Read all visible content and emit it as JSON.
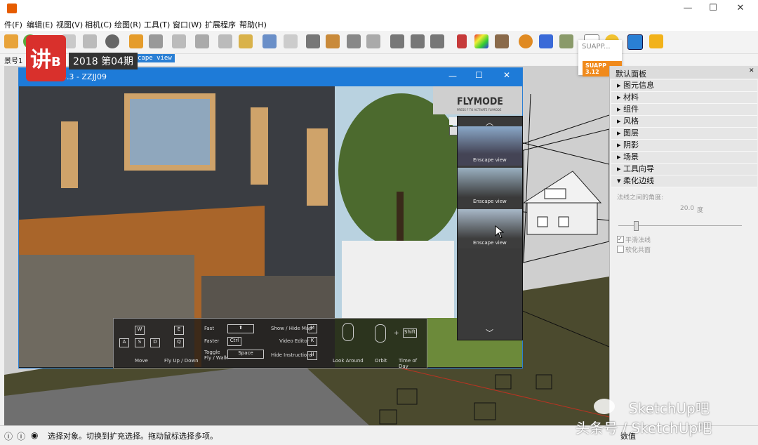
{
  "window": {
    "title_partial": "",
    "minimize": "—",
    "maximize": "☐",
    "close": "✕"
  },
  "menu": [
    "件(F)",
    "编辑(E)",
    "视图(V)",
    "相机(C)",
    "绘图(R)",
    "工具(T)",
    "窗口(W)",
    "扩展程序",
    "帮助(H)"
  ],
  "scene_tab": {
    "label": "景号1",
    "active": "cape view"
  },
  "overlay": {
    "logo_text": "讲",
    "logo_sub": "B",
    "issue": "2018 第04期"
  },
  "suapp": {
    "label": "SUAPP...",
    "badge": "SUAPP 3.12"
  },
  "enscape": {
    "title": "E 2.3.3 - ZZJJ09",
    "flymode_title": "FLYMODE",
    "flymode_sub": "PRESS F TO ACTIVATE FLYMODE",
    "thumbs": [
      "Enscape view",
      "Enscape view",
      "Enscape view"
    ],
    "scroll_up": "︿",
    "scroll_down": "﹀",
    "hud": {
      "keys_move": [
        "W",
        "A",
        "S",
        "D"
      ],
      "keys_fly": [
        "E",
        "Q"
      ],
      "move_label": "Move",
      "fly_label": "Fly Up / Down",
      "fast": "Fast",
      "faster": "Faster",
      "toggle": "Toggle\nFly / Walk",
      "ctrl": "Ctrl",
      "space": "Space",
      "shift_sym": "⬆",
      "show_map": "Show / Hide Map",
      "video_editor": "Video Editor",
      "hide_instr": "Hide Instructions",
      "key_m": "M",
      "key_k": "K",
      "key_h": "H",
      "look_around": "Look Around",
      "orbit": "Orbit",
      "plus": "+",
      "shift": "Shift",
      "time_of_day": "Time of Day"
    }
  },
  "panel": {
    "header": "默认面板",
    "sections": [
      "图元信息",
      "材料",
      "组件",
      "风格",
      "图层",
      "阴影",
      "场景",
      "工具向导",
      "柔化边线"
    ],
    "soften": {
      "angle_label": "法线之间的角度:",
      "angle_value": "20.0",
      "angle_unit": "度",
      "smooth_normals": "平滑法线",
      "soften_coplanar": "软化共面"
    }
  },
  "status": {
    "text": "选择对象。切换到扩充选择。拖动鼠标选择多项。",
    "right": "数值"
  },
  "watermark": {
    "line1": "SketchUp吧",
    "line2": "头条号 / SketchUp吧"
  },
  "colors": {
    "enscape_blue": "#1e7bd8",
    "suapp_orange": "#f08a1c",
    "logo_red": "#d9302c"
  }
}
